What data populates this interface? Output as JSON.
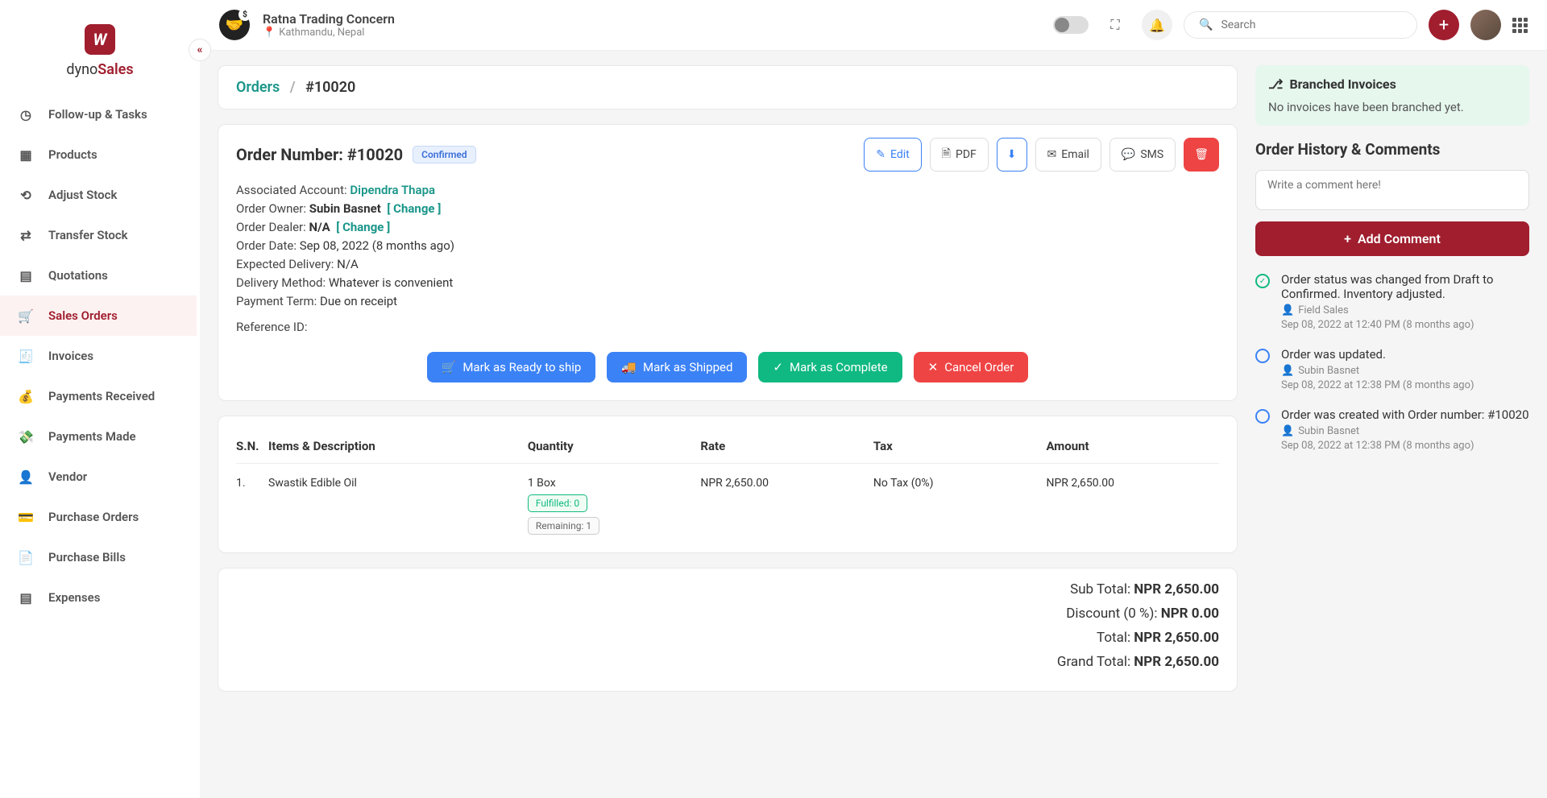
{
  "brand": {
    "part1": "dyno",
    "part2": "Sales"
  },
  "company": {
    "name": "Ratna Trading Concern",
    "location": "Kathmandu, Nepal"
  },
  "search": {
    "placeholder": "Search"
  },
  "nav": {
    "followup": "Follow-up & Tasks",
    "products": "Products",
    "adjust": "Adjust Stock",
    "transfer": "Transfer Stock",
    "quotations": "Quotations",
    "sales": "Sales Orders",
    "invoices": "Invoices",
    "payrecv": "Payments Received",
    "paymade": "Payments Made",
    "vendor": "Vendor",
    "purchorders": "Purchase Orders",
    "purchbills": "Purchase Bills",
    "expenses": "Expenses"
  },
  "breadcrumb": {
    "orders": "Orders",
    "sep": "/",
    "current": "#10020"
  },
  "order": {
    "title_label": "Order Number:",
    "number": "#10020",
    "status": "Confirmed",
    "account_label": "Associated Account:",
    "account": "Dipendra Thapa",
    "owner_label": "Order Owner:",
    "owner": "Subin Basnet",
    "dealer_label": "Order Dealer:",
    "dealer": "N/A",
    "change": "[ Change ]",
    "date_label": "Order Date:",
    "date": "Sep 08, 2022 (8 months ago)",
    "delivery_label": "Expected Delivery:",
    "delivery": "N/A",
    "method_label": "Delivery Method:",
    "method": "Whatever is convenient",
    "payment_label": "Payment Term:",
    "payment": "Due on receipt",
    "ref_label": "Reference ID:"
  },
  "actions": {
    "edit": "Edit",
    "pdf": "PDF",
    "email": "Email",
    "sms": "SMS"
  },
  "status_actions": {
    "ready": "Mark as Ready to ship",
    "shipped": "Mark as Shipped",
    "complete": "Mark as Complete",
    "cancel": "Cancel Order"
  },
  "table": {
    "h_sn": "S.N.",
    "h_desc": "Items & Description",
    "h_qty": "Quantity",
    "h_rate": "Rate",
    "h_tax": "Tax",
    "h_amt": "Amount",
    "row": {
      "sn": "1.",
      "name": "Swastik Edible Oil",
      "qty": "1 Box",
      "rate": "NPR 2,650.00",
      "tax": "No Tax (0%)",
      "amt": "NPR 2,650.00",
      "fulfilled": "Fulfilled: 0",
      "remaining": "Remaining: 1"
    }
  },
  "totals": {
    "subtotal_label": "Sub Total: ",
    "subtotal": "NPR 2,650.00",
    "discount_label": "Discount (0 %): ",
    "discount": "NPR 0.00",
    "total_label": "Total: ",
    "total": "NPR 2,650.00",
    "grand_label": "Grand Total: ",
    "grand": "NPR 2,650.00"
  },
  "branched": {
    "title": "Branched Invoices",
    "empty": "No invoices have been branched yet."
  },
  "history": {
    "title": "Order History & Comments",
    "placeholder": "Write a comment here!",
    "add": "Add Comment",
    "items": {
      "0": {
        "text": "Order status was changed from Draft to Confirmed. Inventory adjusted.",
        "user": "Field Sales",
        "date": "Sep 08, 2022 at 12:40 PM (8 months ago)"
      },
      "1": {
        "text": "Order was updated.",
        "user": "Subin Basnet",
        "date": "Sep 08, 2022 at 12:38 PM (8 months ago)"
      },
      "2": {
        "text": "Order was created with Order number: #10020",
        "user": "Subin Basnet",
        "date": "Sep 08, 2022 at 12:38 PM (8 months ago)"
      }
    }
  }
}
